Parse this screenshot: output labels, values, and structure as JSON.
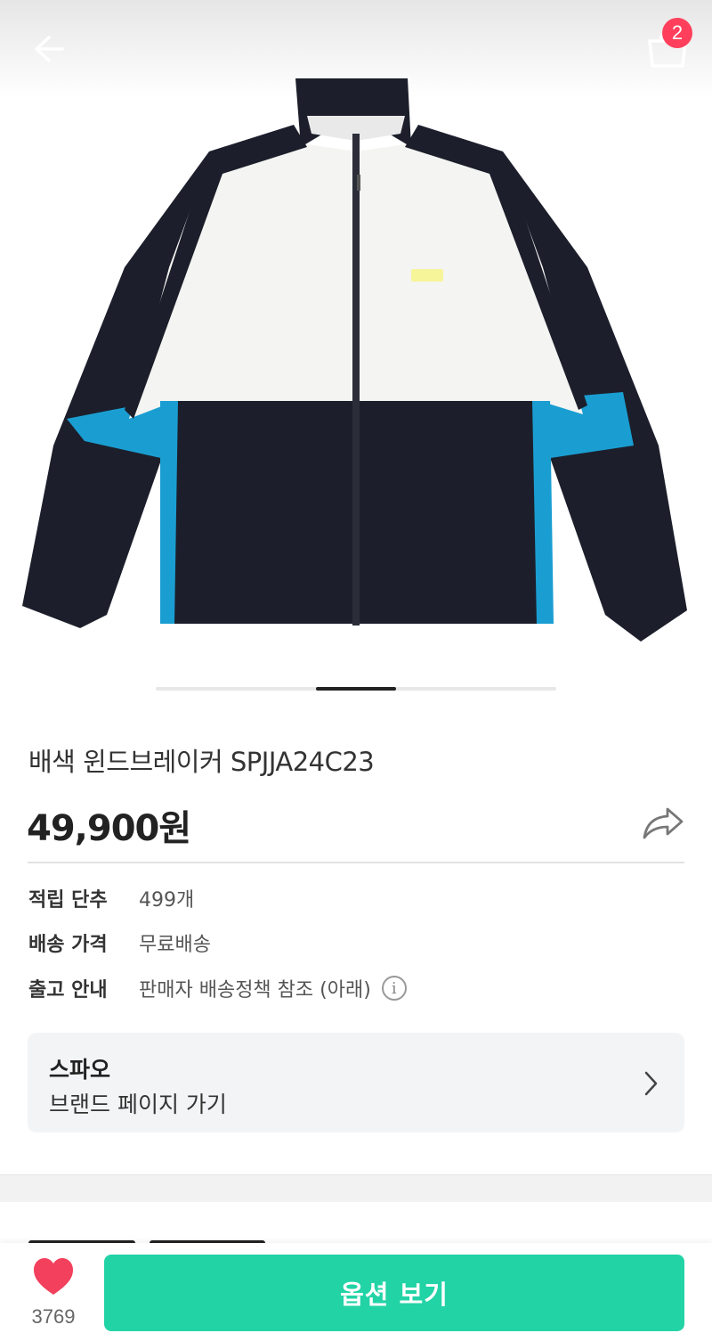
{
  "header": {
    "back_icon": "arrow-left-icon",
    "cart_icon": "shopping-bag-icon",
    "cart_count": "2"
  },
  "gallery": {
    "image_subject": "windbreaker-jacket",
    "page_indicator": {
      "current": 3,
      "total": 5
    },
    "colors": {
      "navy": "#1c1f2b",
      "white": "#f4f4f2",
      "blue": "#1a9ed2"
    }
  },
  "product": {
    "title": "배색 윈드브레이커 SPJJA24C23",
    "price": "49,900원",
    "share_icon": "share-arrow-icon"
  },
  "info": [
    {
      "label": "적립 단추",
      "value": "499개"
    },
    {
      "label": "배송 가격",
      "value": "무료배송"
    },
    {
      "label": "출고 안내",
      "value": "판매자 배송정책 참조 (아래)",
      "icon": "info-icon",
      "icon_glyph": "i"
    }
  ],
  "brand": {
    "name": "스파오",
    "link_label": "브랜드 페이지 가기",
    "chevron_icon": "chevron-right-icon"
  },
  "bottom": {
    "like_icon": "heart-icon",
    "like_count": "3769",
    "option_button": "옵션 보기",
    "accent": "#22d3a6",
    "heart_color": "#f3405d"
  }
}
